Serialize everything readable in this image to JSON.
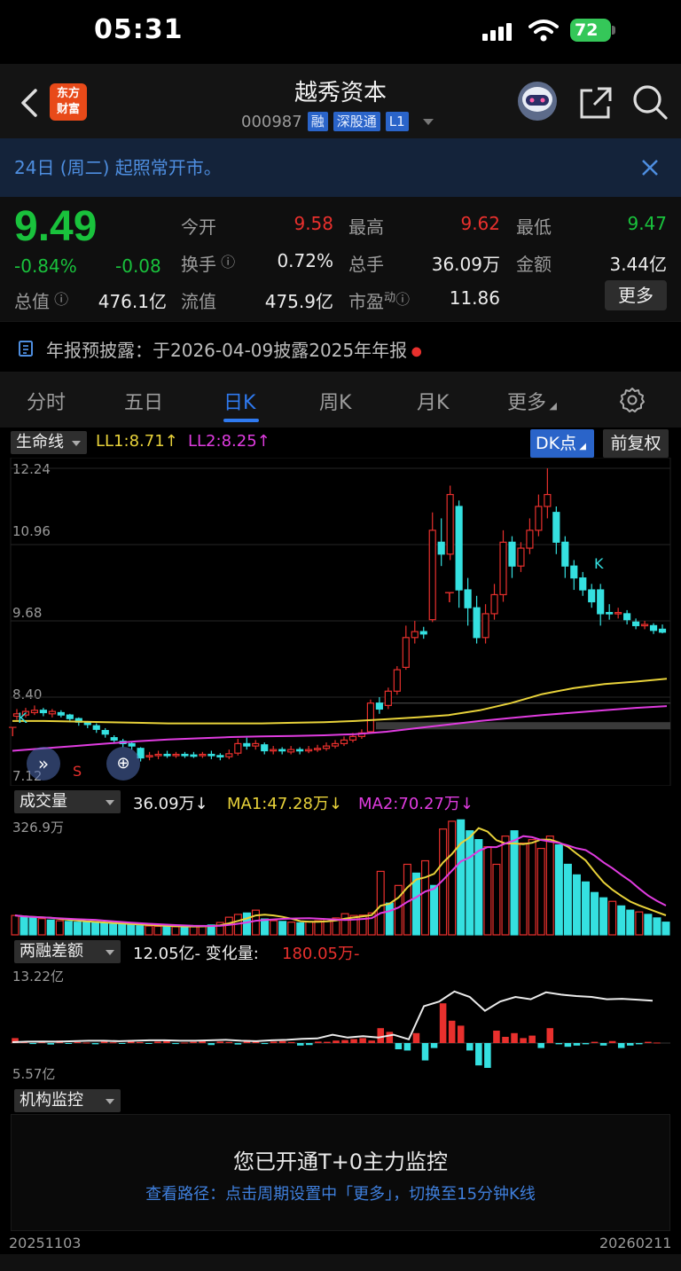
{
  "status_bar": {
    "time": "05:31",
    "battery": "72"
  },
  "header": {
    "logo_line1": "东方",
    "logo_line2": "财富",
    "stock_name": "越秀资本",
    "stock_code": "000987",
    "tags": [
      "融",
      "深股通",
      "L1"
    ]
  },
  "notice": {
    "text": "24日 (周二) 起照常开市。"
  },
  "quote": {
    "price": "9.49",
    "change_pct": "-0.84%",
    "change_abs": "-0.08",
    "fields": [
      {
        "label": "今开",
        "value": "9.58",
        "color": "#e8302d"
      },
      {
        "label": "最高",
        "value": "9.62",
        "color": "#e8302d"
      },
      {
        "label": "最低",
        "value": "9.47",
        "color": "#19c23c"
      },
      {
        "label": "换手",
        "value": "0.72%",
        "color": "#ececec"
      },
      {
        "label": "总手",
        "value": "36.09万",
        "color": "#ececec"
      },
      {
        "label": "金额",
        "value": "3.44亿",
        "color": "#ececec"
      },
      {
        "label": "总值",
        "value": "476.1亿",
        "color": "#ececec"
      },
      {
        "label": "流值",
        "value": "475.9亿",
        "color": "#ececec"
      },
      {
        "label": "市盈",
        "value": "11.86",
        "color": "#ececec",
        "sup": "动"
      }
    ],
    "more_label": "更多"
  },
  "disclosure": {
    "text": "年报预披露：于2026-04-09披露2025年年报"
  },
  "tabs": [
    "分时",
    "五日",
    "日K",
    "周K",
    "月K",
    "更多"
  ],
  "active_tab": "日K",
  "kline": {
    "indicator": "生命线",
    "ll1": "LL1:8.71",
    "ll2": "LL2:8.25",
    "dk_label": "DK点",
    "adjust_label": "前复权",
    "y_ticks": [
      "12.24",
      "10.96",
      "9.68",
      "8.40",
      "7.12"
    ],
    "markers": [
      "K",
      "S",
      "T",
      "K",
      "T"
    ]
  },
  "volume": {
    "indicator": "成交量",
    "value": "36.09万",
    "ma1": "MA1:47.28万",
    "ma2": "MA2:70.27万",
    "max_label": "326.9万"
  },
  "margin": {
    "indicator": "两融差额",
    "value": "12.05亿",
    "change_label": "变化量:",
    "change_value": "180.05万",
    "max_label": "13.22亿",
    "min_label": "5.57亿"
  },
  "monitor": {
    "indicator": "机构监控",
    "title": "您已开通T+0主力监控",
    "subtitle": "查看路径：点击周期设置中「更多」，切换至15分钟K线"
  },
  "dates": {
    "start": "20251103",
    "end": "20260211"
  },
  "chart_data": {
    "type": "candlestick",
    "ylim": [
      7.12,
      12.24
    ],
    "candles": [
      {
        "o": 8.08,
        "c": 8.12,
        "h": 8.2,
        "l": 8.02
      },
      {
        "o": 8.1,
        "c": 8.16,
        "h": 8.22,
        "l": 8.06
      },
      {
        "o": 8.14,
        "c": 8.18,
        "h": 8.26,
        "l": 8.1
      },
      {
        "o": 8.18,
        "c": 8.14,
        "h": 8.22,
        "l": 8.08
      },
      {
        "o": 8.12,
        "c": 8.16,
        "h": 8.2,
        "l": 8.06
      },
      {
        "o": 8.14,
        "c": 8.1,
        "h": 8.18,
        "l": 8.06
      },
      {
        "o": 8.1,
        "c": 8.04,
        "h": 8.12,
        "l": 7.98
      },
      {
        "o": 8.04,
        "c": 7.98,
        "h": 8.06,
        "l": 7.92
      },
      {
        "o": 7.98,
        "c": 7.94,
        "h": 8.0,
        "l": 7.88
      },
      {
        "o": 7.92,
        "c": 7.86,
        "h": 7.96,
        "l": 7.8
      },
      {
        "o": 7.84,
        "c": 7.78,
        "h": 7.88,
        "l": 7.72
      },
      {
        "o": 7.72,
        "c": 7.68,
        "h": 7.76,
        "l": 7.62
      },
      {
        "o": 7.66,
        "c": 7.62,
        "h": 7.7,
        "l": 7.56
      },
      {
        "o": 7.62,
        "c": 7.58,
        "h": 7.66,
        "l": 7.52
      },
      {
        "o": 7.54,
        "c": 7.38,
        "h": 7.56,
        "l": 7.32
      },
      {
        "o": 7.4,
        "c": 7.42,
        "h": 7.48,
        "l": 7.34
      },
      {
        "o": 7.42,
        "c": 7.44,
        "h": 7.5,
        "l": 7.36
      },
      {
        "o": 7.44,
        "c": 7.42,
        "h": 7.5,
        "l": 7.38
      },
      {
        "o": 7.42,
        "c": 7.44,
        "h": 7.48,
        "l": 7.38
      },
      {
        "o": 7.44,
        "c": 7.43,
        "h": 7.48,
        "l": 7.38
      },
      {
        "o": 7.43,
        "c": 7.42,
        "h": 7.48,
        "l": 7.38
      },
      {
        "o": 7.42,
        "c": 7.44,
        "h": 7.48,
        "l": 7.38
      },
      {
        "o": 7.44,
        "c": 7.42,
        "h": 7.5,
        "l": 7.36
      },
      {
        "o": 7.42,
        "c": 7.4,
        "h": 7.46,
        "l": 7.34
      },
      {
        "o": 7.4,
        "c": 7.45,
        "h": 7.52,
        "l": 7.36
      },
      {
        "o": 7.46,
        "c": 7.62,
        "h": 7.7,
        "l": 7.42
      },
      {
        "o": 7.62,
        "c": 7.58,
        "h": 7.72,
        "l": 7.52
      },
      {
        "o": 7.58,
        "c": 7.62,
        "h": 7.68,
        "l": 7.52
      },
      {
        "o": 7.6,
        "c": 7.5,
        "h": 7.64,
        "l": 7.44
      },
      {
        "o": 7.5,
        "c": 7.52,
        "h": 7.58,
        "l": 7.44
      },
      {
        "o": 7.52,
        "c": 7.5,
        "h": 7.56,
        "l": 7.44
      },
      {
        "o": 7.48,
        "c": 7.52,
        "h": 7.58,
        "l": 7.44
      },
      {
        "o": 7.52,
        "c": 7.5,
        "h": 7.56,
        "l": 7.44
      },
      {
        "o": 7.5,
        "c": 7.52,
        "h": 7.58,
        "l": 7.46
      },
      {
        "o": 7.52,
        "c": 7.54,
        "h": 7.6,
        "l": 7.48
      },
      {
        "o": 7.54,
        "c": 7.58,
        "h": 7.64,
        "l": 7.5
      },
      {
        "o": 7.58,
        "c": 7.62,
        "h": 7.68,
        "l": 7.54
      },
      {
        "o": 7.62,
        "c": 7.68,
        "h": 7.74,
        "l": 7.58
      },
      {
        "o": 7.68,
        "c": 7.74,
        "h": 7.8,
        "l": 7.64
      },
      {
        "o": 7.74,
        "c": 7.8,
        "h": 7.86,
        "l": 7.7
      },
      {
        "o": 7.82,
        "c": 8.3,
        "h": 8.36,
        "l": 7.8
      },
      {
        "o": 8.3,
        "c": 8.2,
        "h": 8.4,
        "l": 8.12
      },
      {
        "o": 8.26,
        "c": 8.5,
        "h": 8.56,
        "l": 8.2
      },
      {
        "o": 8.5,
        "c": 8.86,
        "h": 8.92,
        "l": 8.44
      },
      {
        "o": 8.9,
        "c": 9.4,
        "h": 9.6,
        "l": 8.86
      },
      {
        "o": 9.4,
        "c": 9.5,
        "h": 9.68,
        "l": 9.3
      },
      {
        "o": 9.5,
        "c": 9.46,
        "h": 9.58,
        "l": 9.38
      },
      {
        "o": 9.7,
        "c": 11.2,
        "h": 11.5,
        "l": 9.66
      },
      {
        "o": 11.0,
        "c": 10.8,
        "h": 11.4,
        "l": 10.6
      },
      {
        "o": 10.8,
        "c": 11.8,
        "h": 11.95,
        "l": 10.7
      },
      {
        "o": 11.6,
        "c": 10.2,
        "h": 11.7,
        "l": 9.9
      },
      {
        "o": 10.2,
        "c": 9.9,
        "h": 10.4,
        "l": 9.6
      },
      {
        "o": 9.9,
        "c": 9.4,
        "h": 10.1,
        "l": 9.3
      },
      {
        "o": 9.4,
        "c": 9.8,
        "h": 9.96,
        "l": 9.3
      },
      {
        "o": 9.8,
        "c": 10.12,
        "h": 10.3,
        "l": 9.7
      },
      {
        "o": 10.12,
        "c": 11.0,
        "h": 11.2,
        "l": 10.0
      },
      {
        "o": 11.0,
        "c": 10.6,
        "h": 11.1,
        "l": 10.4
      },
      {
        "o": 10.6,
        "c": 10.9,
        "h": 11.0,
        "l": 10.5
      },
      {
        "o": 10.9,
        "c": 11.2,
        "h": 11.4,
        "l": 10.8
      },
      {
        "o": 11.2,
        "c": 11.6,
        "h": 11.8,
        "l": 11.1
      },
      {
        "o": 11.6,
        "c": 11.8,
        "h": 12.24,
        "l": 11.4
      },
      {
        "o": 11.5,
        "c": 11.0,
        "h": 11.6,
        "l": 10.8
      },
      {
        "o": 11.0,
        "c": 10.6,
        "h": 11.1,
        "l": 10.4
      },
      {
        "o": 10.6,
        "c": 10.4,
        "h": 10.7,
        "l": 10.2
      },
      {
        "o": 10.4,
        "c": 10.2,
        "h": 10.5,
        "l": 10.1
      },
      {
        "o": 10.2,
        "c": 10.0,
        "h": 10.3,
        "l": 9.9
      },
      {
        "o": 10.2,
        "c": 9.8,
        "h": 10.3,
        "l": 9.6
      },
      {
        "o": 9.82,
        "c": 9.8,
        "h": 9.96,
        "l": 9.7
      },
      {
        "o": 9.8,
        "c": 9.82,
        "h": 9.9,
        "l": 9.72
      },
      {
        "o": 9.8,
        "c": 9.7,
        "h": 9.86,
        "l": 9.62
      },
      {
        "o": 9.66,
        "c": 9.6,
        "h": 9.72,
        "l": 9.54
      },
      {
        "o": 9.6,
        "c": 9.62,
        "h": 9.68,
        "l": 9.54
      },
      {
        "o": 9.6,
        "c": 9.52,
        "h": 9.64,
        "l": 9.46
      },
      {
        "o": 9.54,
        "c": 9.49,
        "h": 9.62,
        "l": 9.47
      }
    ],
    "ll1_line": [
      8.0,
      8.0,
      7.99,
      7.98,
      7.97,
      7.96,
      7.96,
      7.96,
      7.96,
      7.97,
      7.98,
      8.0,
      8.03,
      8.06,
      8.1,
      8.18,
      8.3,
      8.45,
      8.55,
      8.62,
      8.66,
      8.71
    ],
    "ll2_line": [
      7.5,
      7.54,
      7.58,
      7.62,
      7.66,
      7.69,
      7.71,
      7.73,
      7.74,
      7.75,
      7.76,
      7.78,
      7.82,
      7.88,
      7.94,
      8.0,
      8.05,
      8.1,
      8.14,
      8.18,
      8.22,
      8.25
    ],
    "volume_wan": [
      55,
      50,
      48,
      46,
      42,
      40,
      38,
      36,
      35,
      34,
      33,
      30,
      30,
      28,
      26,
      25,
      24,
      24,
      23,
      23,
      24,
      26,
      28,
      35,
      50,
      58,
      62,
      70,
      45,
      40,
      38,
      36,
      34,
      38,
      40,
      44,
      48,
      60,
      55,
      56,
      62,
      180,
      90,
      140,
      200,
      175,
      210,
      140,
      300,
      322,
      326,
      295,
      270,
      250,
      200,
      280,
      295,
      260,
      270,
      245,
      280,
      255,
      200,
      170,
      150,
      120,
      105,
      95,
      82,
      70,
      65,
      58,
      48,
      36
    ],
    "volume_up": [
      true,
      false,
      false,
      true,
      false,
      true,
      false,
      false,
      false,
      false,
      false,
      false,
      false,
      false,
      false,
      true,
      true,
      false,
      true,
      false,
      true,
      true,
      false,
      true,
      true,
      true,
      false,
      true,
      false,
      true,
      false,
      true,
      false,
      true,
      true,
      true,
      true,
      true,
      true,
      true,
      true,
      true,
      false,
      true,
      true,
      false,
      true,
      false,
      true,
      true,
      false,
      false,
      false,
      true,
      true,
      true,
      false,
      true,
      true,
      true,
      true,
      false,
      false,
      false,
      false,
      false,
      false,
      true,
      false,
      false,
      true,
      false,
      false,
      false
    ],
    "margin_diff_yi": [
      0.2,
      0.05,
      -0.04,
      0.08,
      -0.06,
      0.1,
      -0.02,
      0.04,
      0.02,
      -0.05,
      0.06,
      0.03,
      -0.02,
      0.12,
      0.04,
      -0.03,
      0.06,
      0.1,
      -0.04,
      0.02,
      0.05,
      0.08,
      -0.08,
      0.06,
      0.04,
      -0.06,
      0.12,
      0.1,
      -0.04,
      0.06,
      0.08,
      0.04,
      -0.1,
      -0.08,
      0.06,
      0.05,
      0.1,
      0.12,
      0.16,
      0.2,
      0.1,
      0.6,
      0.45,
      -0.25,
      -0.3,
      0.4,
      -0.7,
      -0.2,
      1.6,
      0.9,
      0.7,
      -0.3,
      -0.9,
      -1.0,
      0.5,
      0.25,
      0.4,
      0.2,
      0.3,
      -0.2,
      0.6,
      -0.05,
      -0.15,
      -0.1,
      -0.05,
      0.05,
      -0.1,
      0.08,
      -0.2,
      -0.1,
      -0.05,
      0.05,
      0.02,
      0.0
    ],
    "margin_line": [
      0.92,
      0.93,
      0.935,
      0.93,
      0.94,
      0.95,
      0.95,
      0.94,
      0.95,
      0.96,
      0.96,
      0.95,
      0.95,
      0.96,
      0.97,
      0.95,
      0.94,
      0.96,
      0.97,
      0.99,
      1.0,
      1.08,
      1.02,
      1.05,
      1.02,
      1.08,
      0.98,
      1.7,
      1.8,
      2.02,
      1.9,
      1.6,
      1.8,
      1.9,
      1.85,
      2.0,
      1.95,
      1.92,
      1.9,
      1.85,
      1.86,
      1.84,
      1.82
    ]
  }
}
